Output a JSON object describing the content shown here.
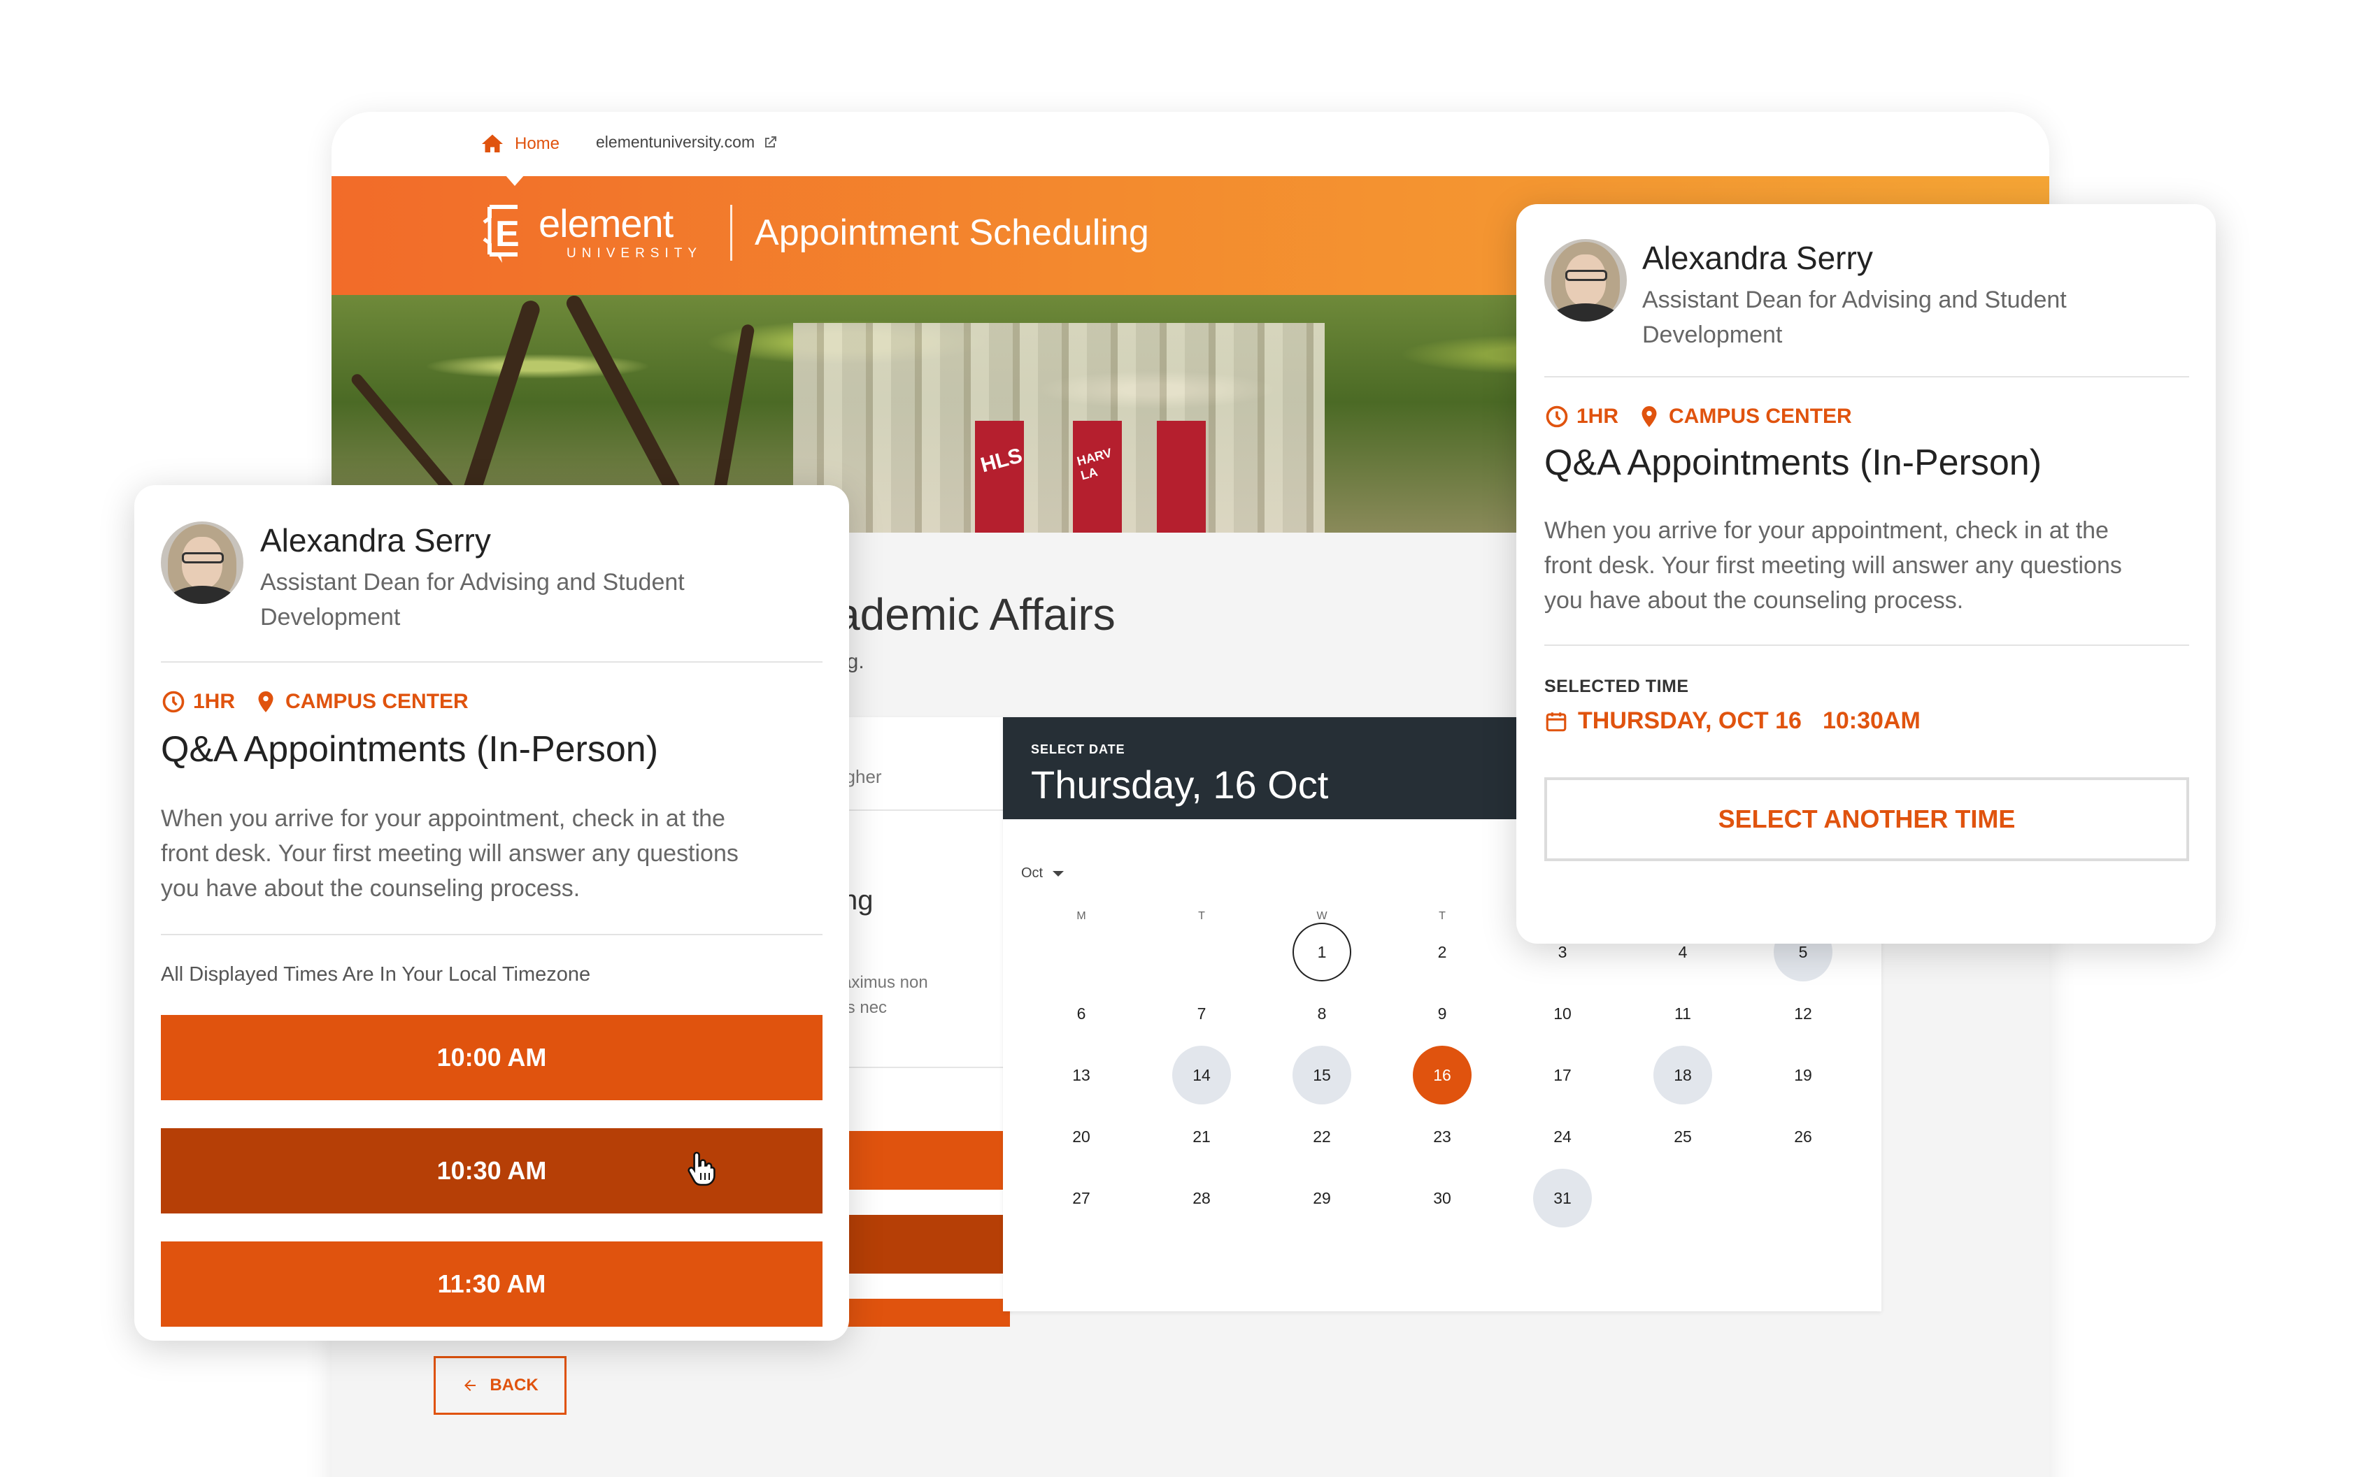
{
  "topbar": {
    "home_label": "Home",
    "site_url": "elementuniversity.com"
  },
  "banner": {
    "logo_word": "element",
    "logo_sub": "UNIVERSITY",
    "logo_letter": "E",
    "title": "Appointment Scheduling"
  },
  "hero": {
    "flag1": "HLS",
    "flag2": "HARV LA"
  },
  "main": {
    "heading_fragment": "ademic Affairs",
    "sub_fragment": "ng.",
    "service_fragments": {
      "f1": "Higher",
      "f2": "ting",
      "f3a": "maximus non",
      "f3b": "rpis nec"
    },
    "back_label": "BACK"
  },
  "calendar": {
    "select_label": "SELECT DATE",
    "selected_date": "Thursday, 16 Oct",
    "month": "Oct",
    "weekdays": [
      "M",
      "T",
      "W",
      "T"
    ],
    "days": [
      {
        "n": "1",
        "state": "today"
      },
      {
        "n": "2"
      },
      {
        "n": "3"
      },
      {
        "n": "4"
      },
      {
        "n": "5",
        "state": "avail"
      },
      {
        "n": "6"
      },
      {
        "n": "7"
      },
      {
        "n": "8"
      },
      {
        "n": "9"
      },
      {
        "n": "10"
      },
      {
        "n": "11"
      },
      {
        "n": "12"
      },
      {
        "n": "13"
      },
      {
        "n": "14",
        "state": "avail"
      },
      {
        "n": "15",
        "state": "avail"
      },
      {
        "n": "16",
        "state": "selected"
      },
      {
        "n": "17"
      },
      {
        "n": "18",
        "state": "avail"
      },
      {
        "n": "19"
      },
      {
        "n": "20"
      },
      {
        "n": "21"
      },
      {
        "n": "22"
      },
      {
        "n": "23"
      },
      {
        "n": "24"
      },
      {
        "n": "25"
      },
      {
        "n": "26"
      },
      {
        "n": "27"
      },
      {
        "n": "28"
      },
      {
        "n": "29"
      },
      {
        "n": "30"
      },
      {
        "n": "31",
        "state": "avail"
      }
    ]
  },
  "left_card": {
    "name": "Alexandra Serry",
    "role_line1": "Assistant Dean for Advising and Student",
    "role_line2": "Development",
    "duration": "1HR",
    "location": "CAMPUS CENTER",
    "title": "Q&A Appointments (In-Person)",
    "desc_line1": "When you arrive for your appointment, check in at the",
    "desc_line2": "front desk. Your first meeting will answer any questions",
    "desc_line3": "you have about the counseling process.",
    "timezone_note": "All Displayed Times Are In Your Local Timezone",
    "times": [
      "10:00 AM",
      "10:30 AM",
      "11:30 AM"
    ]
  },
  "right_card": {
    "name": "Alexandra Serry",
    "role_line1": "Assistant Dean for Advising and Student",
    "role_line2": "Development",
    "duration": "1HR",
    "location": "CAMPUS CENTER",
    "title": "Q&A Appointments (In-Person)",
    "desc_line1": "When you arrive for your appointment, check in at the",
    "desc_line2": "front desk. Your first meeting will answer any questions",
    "desc_line3": "you have about the counseling process.",
    "selected_time_label": "SELECTED TIME",
    "selected_day": "THURSDAY, OCT 16",
    "selected_time": "10:30AM",
    "another_label": "SELECT ANOTHER TIME"
  },
  "colors": {
    "accent": "#e0530e",
    "accent_dark": "#b63f06",
    "calendar_header": "#262f36",
    "available_day": "#e2e6ec"
  },
  "icons": [
    "home-icon",
    "external-link-icon",
    "clock-icon",
    "location-pin-icon",
    "calendar-icon",
    "arrow-left-icon",
    "hand-cursor-icon"
  ]
}
